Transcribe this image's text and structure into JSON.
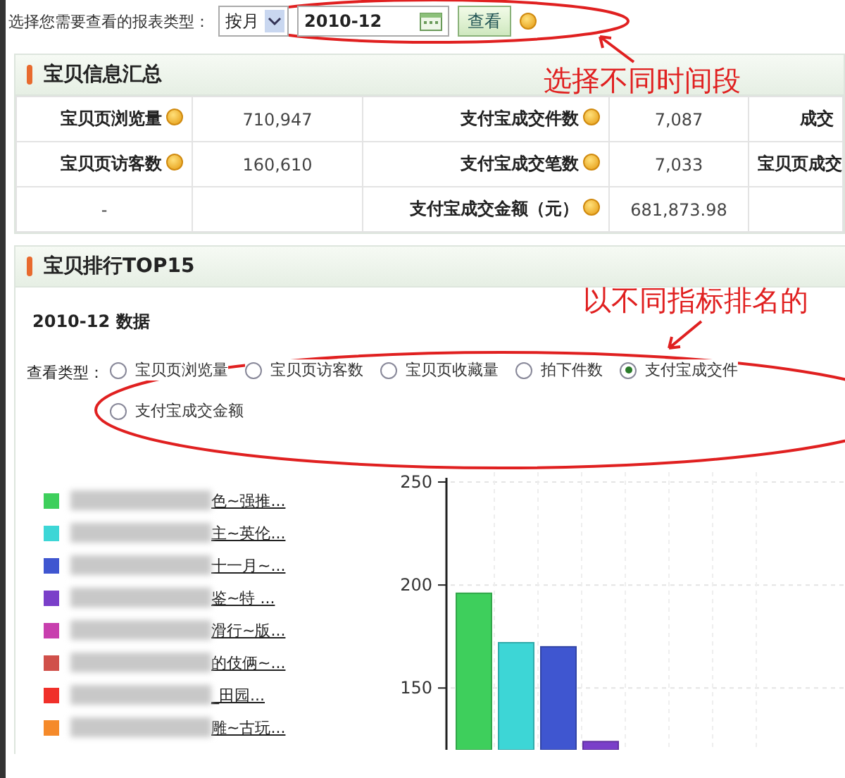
{
  "filter_bar": {
    "label": "选择您需要查看的报表类型：",
    "period": "按月",
    "date": "2010-12",
    "view_button": "查看"
  },
  "summary": {
    "title": "宝贝信息汇总",
    "rows": [
      {
        "cells": [
          {
            "kind": "label",
            "text": "宝贝页浏览量",
            "help": true
          },
          {
            "kind": "value",
            "text": "710,947"
          },
          {
            "kind": "label",
            "text": "支付宝成交件数",
            "help": true
          },
          {
            "kind": "value",
            "text": "7,087"
          },
          {
            "kind": "label",
            "text": "成交"
          }
        ]
      },
      {
        "cells": [
          {
            "kind": "label",
            "text": "宝贝页访客数",
            "help": true
          },
          {
            "kind": "value",
            "text": "160,610"
          },
          {
            "kind": "label",
            "text": "支付宝成交笔数",
            "help": true
          },
          {
            "kind": "value",
            "text": "7,033"
          },
          {
            "kind": "label",
            "text": "宝贝页成交"
          }
        ]
      },
      {
        "cells": [
          {
            "kind": "value",
            "text": "-"
          },
          {
            "kind": "value",
            "text": ""
          },
          {
            "kind": "label",
            "text": "支付宝成交金额（元）",
            "help": true
          },
          {
            "kind": "value",
            "text": "681,873.98"
          },
          {
            "kind": "value",
            "text": ""
          }
        ]
      }
    ]
  },
  "ranking": {
    "title": "宝贝排行TOP15",
    "subtitle": "2010-12 数据",
    "view_label": "查看类型：",
    "options": [
      {
        "label": "宝贝页浏览量",
        "selected": false
      },
      {
        "label": "宝贝页访客数",
        "selected": false
      },
      {
        "label": "宝贝页收藏量",
        "selected": false
      },
      {
        "label": "拍下件数",
        "selected": false
      },
      {
        "label": "支付宝成交件",
        "selected": true
      },
      {
        "label": "支付宝成交金额",
        "selected": false
      }
    ],
    "legend": [
      {
        "text": "色~强推...",
        "color": "#3ecf5c"
      },
      {
        "text": "主~英伦...",
        "color": "#3dd6d6"
      },
      {
        "text": "十一月~...",
        "color": "#3f56d0"
      },
      {
        "text": "鉴~特 ...",
        "color": "#7a3fc9"
      },
      {
        "text": "滑行~版...",
        "color": "#c83fae"
      },
      {
        "text": "的伎俩~...",
        "color": "#d0504a"
      },
      {
        "text": "_田园...",
        "color": "#f0302a"
      },
      {
        "text": "雕~古玩...",
        "color": "#f58a2a"
      }
    ],
    "chart_data": {
      "type": "bar",
      "stacked": true,
      "series": [
        {
          "color": "#3ecf5c",
          "values": [
            196,
            null,
            null,
            null
          ]
        },
        {
          "color": "#3dd6d6",
          "values": [
            null,
            172,
            null,
            null
          ]
        },
        {
          "color": "#3f56d0",
          "values": [
            null,
            null,
            170,
            null
          ]
        },
        {
          "color": "#7a3fc9",
          "values": [
            null,
            null,
            null,
            124
          ]
        }
      ],
      "yticks": [
        150,
        200,
        250
      ],
      "ylim": [
        120,
        250
      ]
    }
  },
  "annotations": [
    {
      "text": "选择不同时间段"
    },
    {
      "text": "以不同指标排名的"
    }
  ]
}
